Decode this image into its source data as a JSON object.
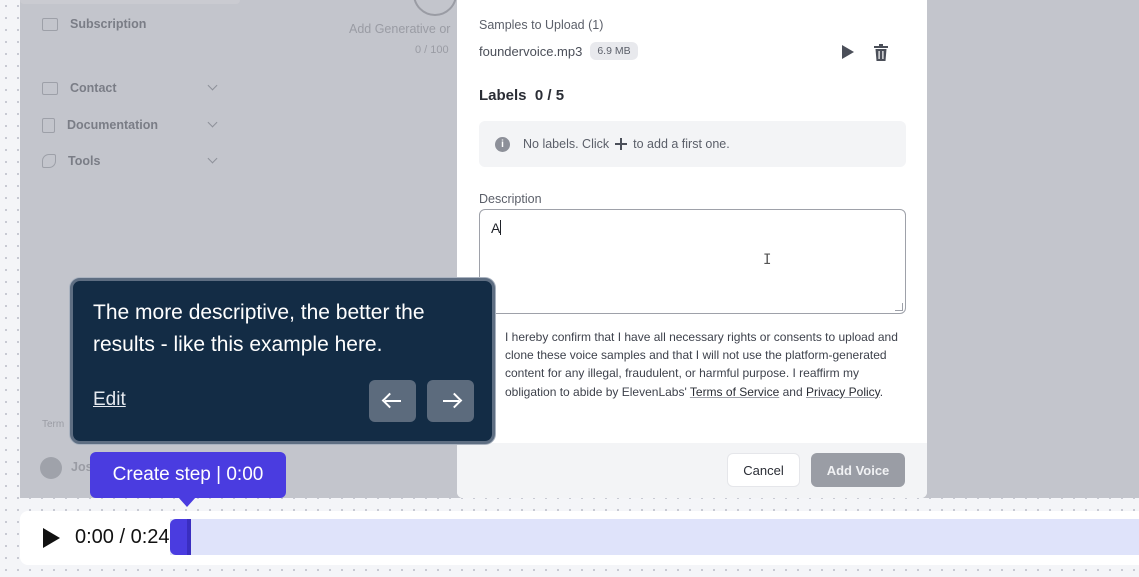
{
  "background": {
    "sidebar": {
      "items": [
        {
          "label": "Subscription",
          "has_chevron": false
        },
        {
          "label": "Contact",
          "has_chevron": true
        },
        {
          "label": "Documentation",
          "has_chevron": true
        },
        {
          "label": "Tools",
          "has_chevron": true
        }
      ],
      "footer_text": "Term",
      "user_name": "Jos"
    },
    "main_partial": {
      "add_text": "Add Generative or ",
      "counter": "0 / 100"
    }
  },
  "modal": {
    "samples_title": "Samples to Upload (1)",
    "file": {
      "name": "foundervoice.mp3",
      "size": "6.9 MB"
    },
    "labels_title": "Labels  0 / 5",
    "info": {
      "before": "No labels. Click",
      "after": "to add a first one."
    },
    "description_label": "Description",
    "description_value": "A",
    "consent": {
      "text": "I hereby confirm that I have all necessary rights or consents to upload and clone these voice samples and that I will not use the platform-generated content for any illegal, fraudulent, or harmful purpose. I reaffirm my obligation to abide by ElevenLabs'",
      "terms_link": "Terms of Service",
      "and": "and",
      "privacy_link": "Privacy Policy",
      "end": "."
    },
    "cancel_label": "Cancel",
    "add_voice_label": "Add Voice"
  },
  "tooltip": {
    "text": "The more descriptive, the better the results - like this example here.",
    "edit_label": "Edit"
  },
  "step_label": "Create step | 0:00",
  "player": {
    "time": "0:00 / 0:24"
  },
  "colors": {
    "accent": "#4a3ce0",
    "tooltip_bg": "#132c45",
    "disabled_button": "#9a9da5"
  }
}
